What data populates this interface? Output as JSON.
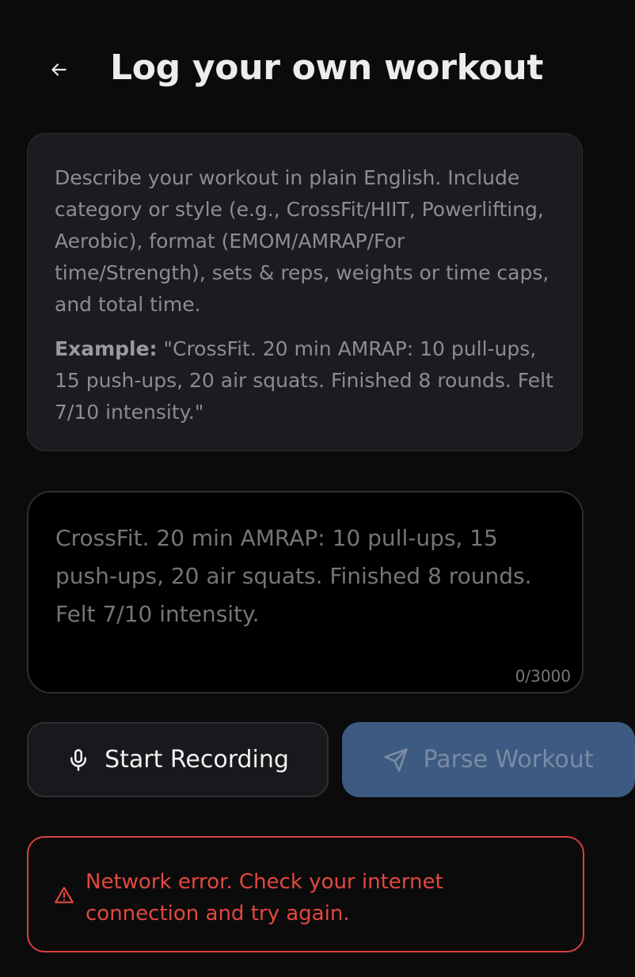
{
  "header": {
    "back_icon": "arrow-left-icon",
    "title": "Log your own workout"
  },
  "instructions": {
    "description": "Describe your workout in plain English. Include category or style (e.g., CrossFit/HIIT, Powerlifting, Aerobic), format (EMOM/AMRAP/For time/Strength), sets & reps, weights or time caps, and total time.",
    "example_label": "Example:",
    "example_text": " \"CrossFit. 20 min AMRAP: 10 pull-ups, 15 push-ups, 20 air squats. Finished 8 rounds. Felt 7/10 intensity.\""
  },
  "workout_input": {
    "placeholder": "CrossFit. 20 min AMRAP: 10 pull-ups, 15 push-ups, 20 air squats. Finished 8 rounds. Felt 7/10 intensity.",
    "value": "",
    "counter": "0/3000"
  },
  "actions": {
    "record_label": "Start Recording",
    "record_icon": "microphone-icon",
    "parse_label": "Parse Workout",
    "parse_icon": "send-icon"
  },
  "error": {
    "icon": "warning-triangle-icon",
    "message": "Network error. Check your internet connection and try again."
  },
  "colors": {
    "background": "#0b0b0b",
    "card": "#1b1c1f",
    "primary_disabled": "#3c5a82",
    "error": "#e4473f"
  }
}
